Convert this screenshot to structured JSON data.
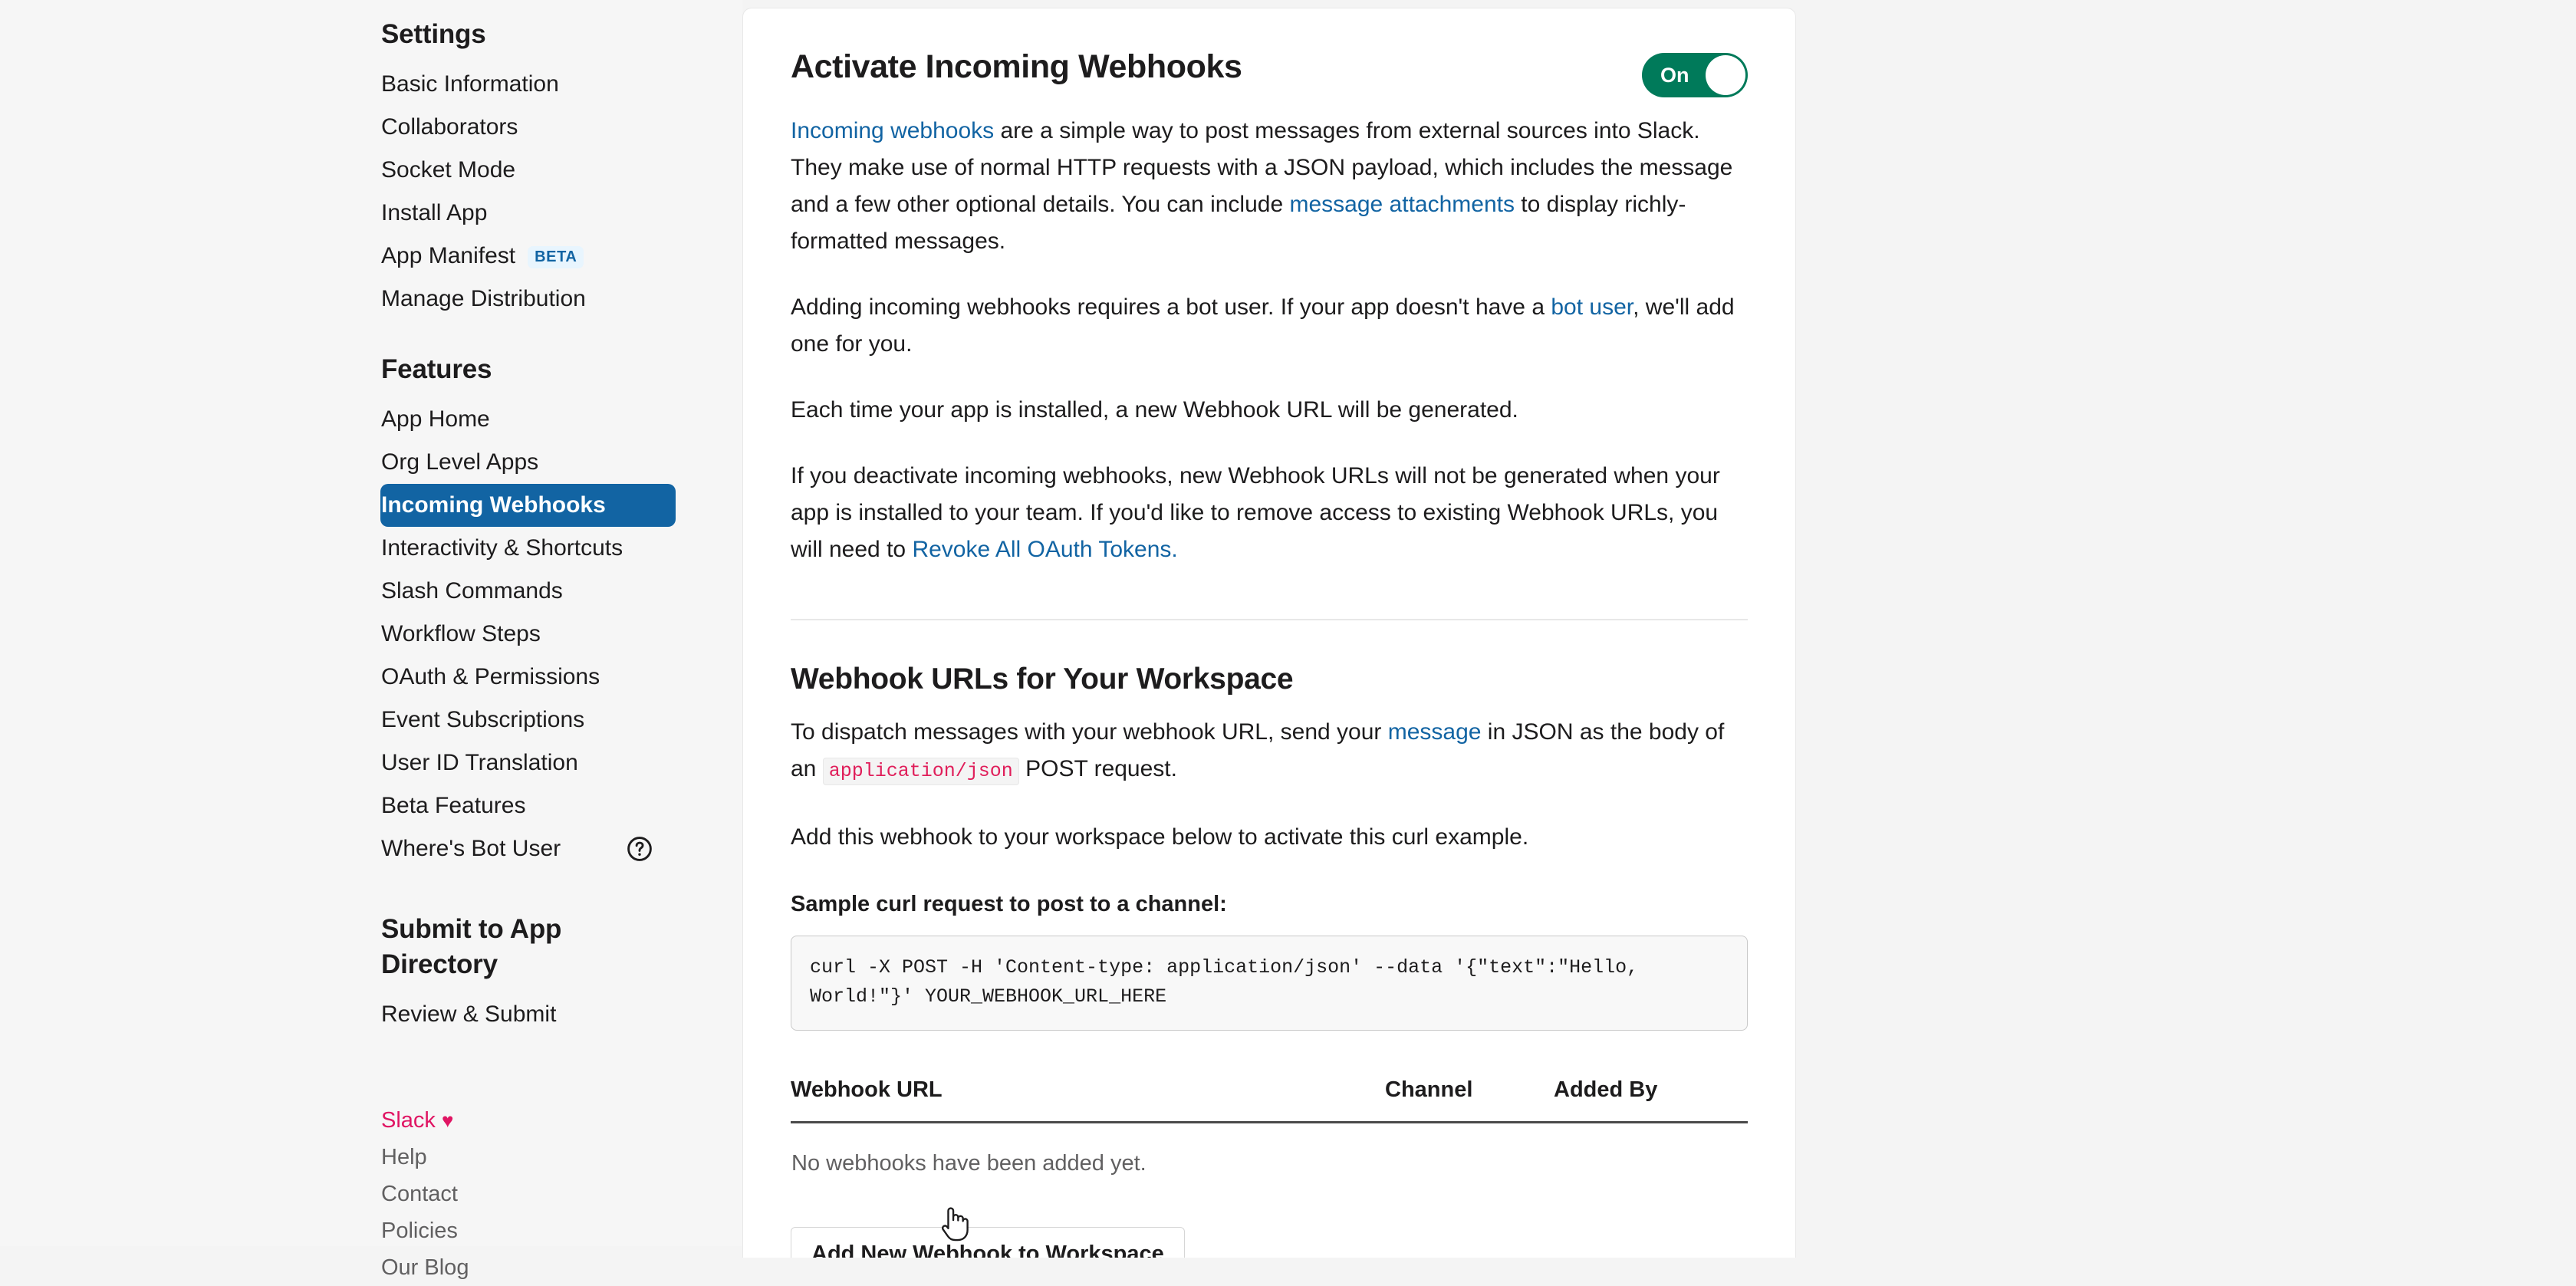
{
  "sidebar": {
    "groups": [
      {
        "title": "Settings",
        "items": [
          {
            "label": "Basic Information"
          },
          {
            "label": "Collaborators"
          },
          {
            "label": "Socket Mode"
          },
          {
            "label": "Install App"
          },
          {
            "label": "App Manifest",
            "badge": "BETA"
          },
          {
            "label": "Manage Distribution"
          }
        ]
      },
      {
        "title": "Features",
        "items": [
          {
            "label": "App Home"
          },
          {
            "label": "Org Level Apps"
          },
          {
            "label": "Incoming Webhooks",
            "active": true
          },
          {
            "label": "Interactivity & Shortcuts"
          },
          {
            "label": "Slash Commands"
          },
          {
            "label": "Workflow Steps"
          },
          {
            "label": "OAuth & Permissions"
          },
          {
            "label": "Event Subscriptions"
          },
          {
            "label": "User ID Translation"
          },
          {
            "label": "Beta Features"
          },
          {
            "label": "Where's Bot User",
            "help": true
          }
        ]
      },
      {
        "title": "Submit to App Directory",
        "items": [
          {
            "label": "Review & Submit"
          }
        ]
      }
    ],
    "footer_links": [
      {
        "label": "Slack",
        "heart": true
      },
      {
        "label": "Help"
      },
      {
        "label": "Contact"
      },
      {
        "label": "Policies"
      },
      {
        "label": "Our Blog"
      }
    ],
    "colors": {
      "active_background": "#1264a3",
      "badge_background": "#e8f5fe",
      "badge_text": "#1264a3",
      "slack_pink": "#e01563",
      "background": "#f6f6f6"
    }
  },
  "main": {
    "title": "Activate Incoming Webhooks",
    "toggle": {
      "label": "On",
      "state": "on",
      "color": "#007a5a"
    },
    "paragraph1": {
      "link1": "Incoming webhooks",
      "text1": " are a simple way to post messages from external sources into Slack. They make use of normal HTTP requests with a JSON payload, which includes the message and a few other optional details. You can include ",
      "link2": "message attachments",
      "text2": " to display richly-formatted messages."
    },
    "paragraph2": {
      "text1": "Adding incoming webhooks requires a bot user. If your app doesn't have a ",
      "link1": "bot user",
      "text2": ", we'll add one for you."
    },
    "paragraph3": "Each time your app is installed, a new Webhook URL will be generated.",
    "paragraph4": {
      "text1": "If you deactivate incoming webhooks, new Webhook URLs will not be generated when your app is installed to your team. If you'd like to remove access to existing Webhook URLs, you will need to ",
      "link1": "Revoke All OAuth Tokens."
    },
    "section2_title": "Webhook URLs for Your Workspace",
    "paragraph5": {
      "text1": "To dispatch messages with your webhook URL, send your ",
      "link1": "message",
      "text2": " in JSON as the body of an ",
      "code1": "application/json",
      "text3": " POST request."
    },
    "paragraph6": "Add this webhook to your workspace below to activate this curl example.",
    "sample_label": "Sample curl request to post to a channel:",
    "curl_command": "curl -X POST -H 'Content-type: application/json' --data '{\"text\":\"Hello, World!\"}' YOUR_WEBHOOK_URL_HERE",
    "table": {
      "headers": [
        "Webhook URL",
        "Channel",
        "Added By"
      ],
      "empty_message": "No webhooks have been added yet.",
      "rows": []
    },
    "add_button_label": "Add New Webhook to Workspace"
  }
}
